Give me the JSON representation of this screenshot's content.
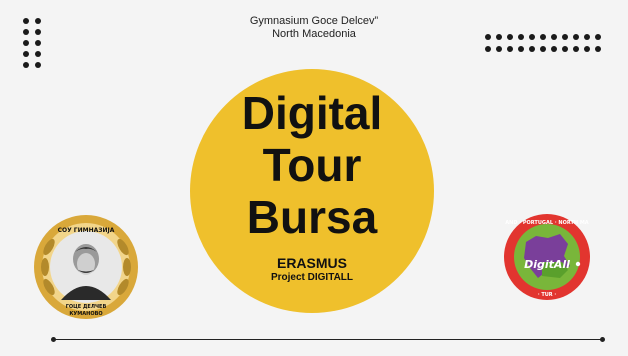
{
  "header": {
    "school_line1": "Gymnasium Goce Delcev”",
    "school_line2": "North Macedonia"
  },
  "hero": {
    "title_line1": "Digital",
    "title_line2": "Tour",
    "title_line3": "Bursa",
    "subtitle": "ERASMUS",
    "project": "Project DIGITALL"
  },
  "logos": {
    "left_text": "СОУ ГИМНАЗИЈА ГОЦЕ ДЕЛЧЕВ КУМАНОВО",
    "right_text": "DigitAll"
  },
  "colors": {
    "accent": "#efc02c",
    "background": "#f4f4f4",
    "text": "#111111"
  }
}
